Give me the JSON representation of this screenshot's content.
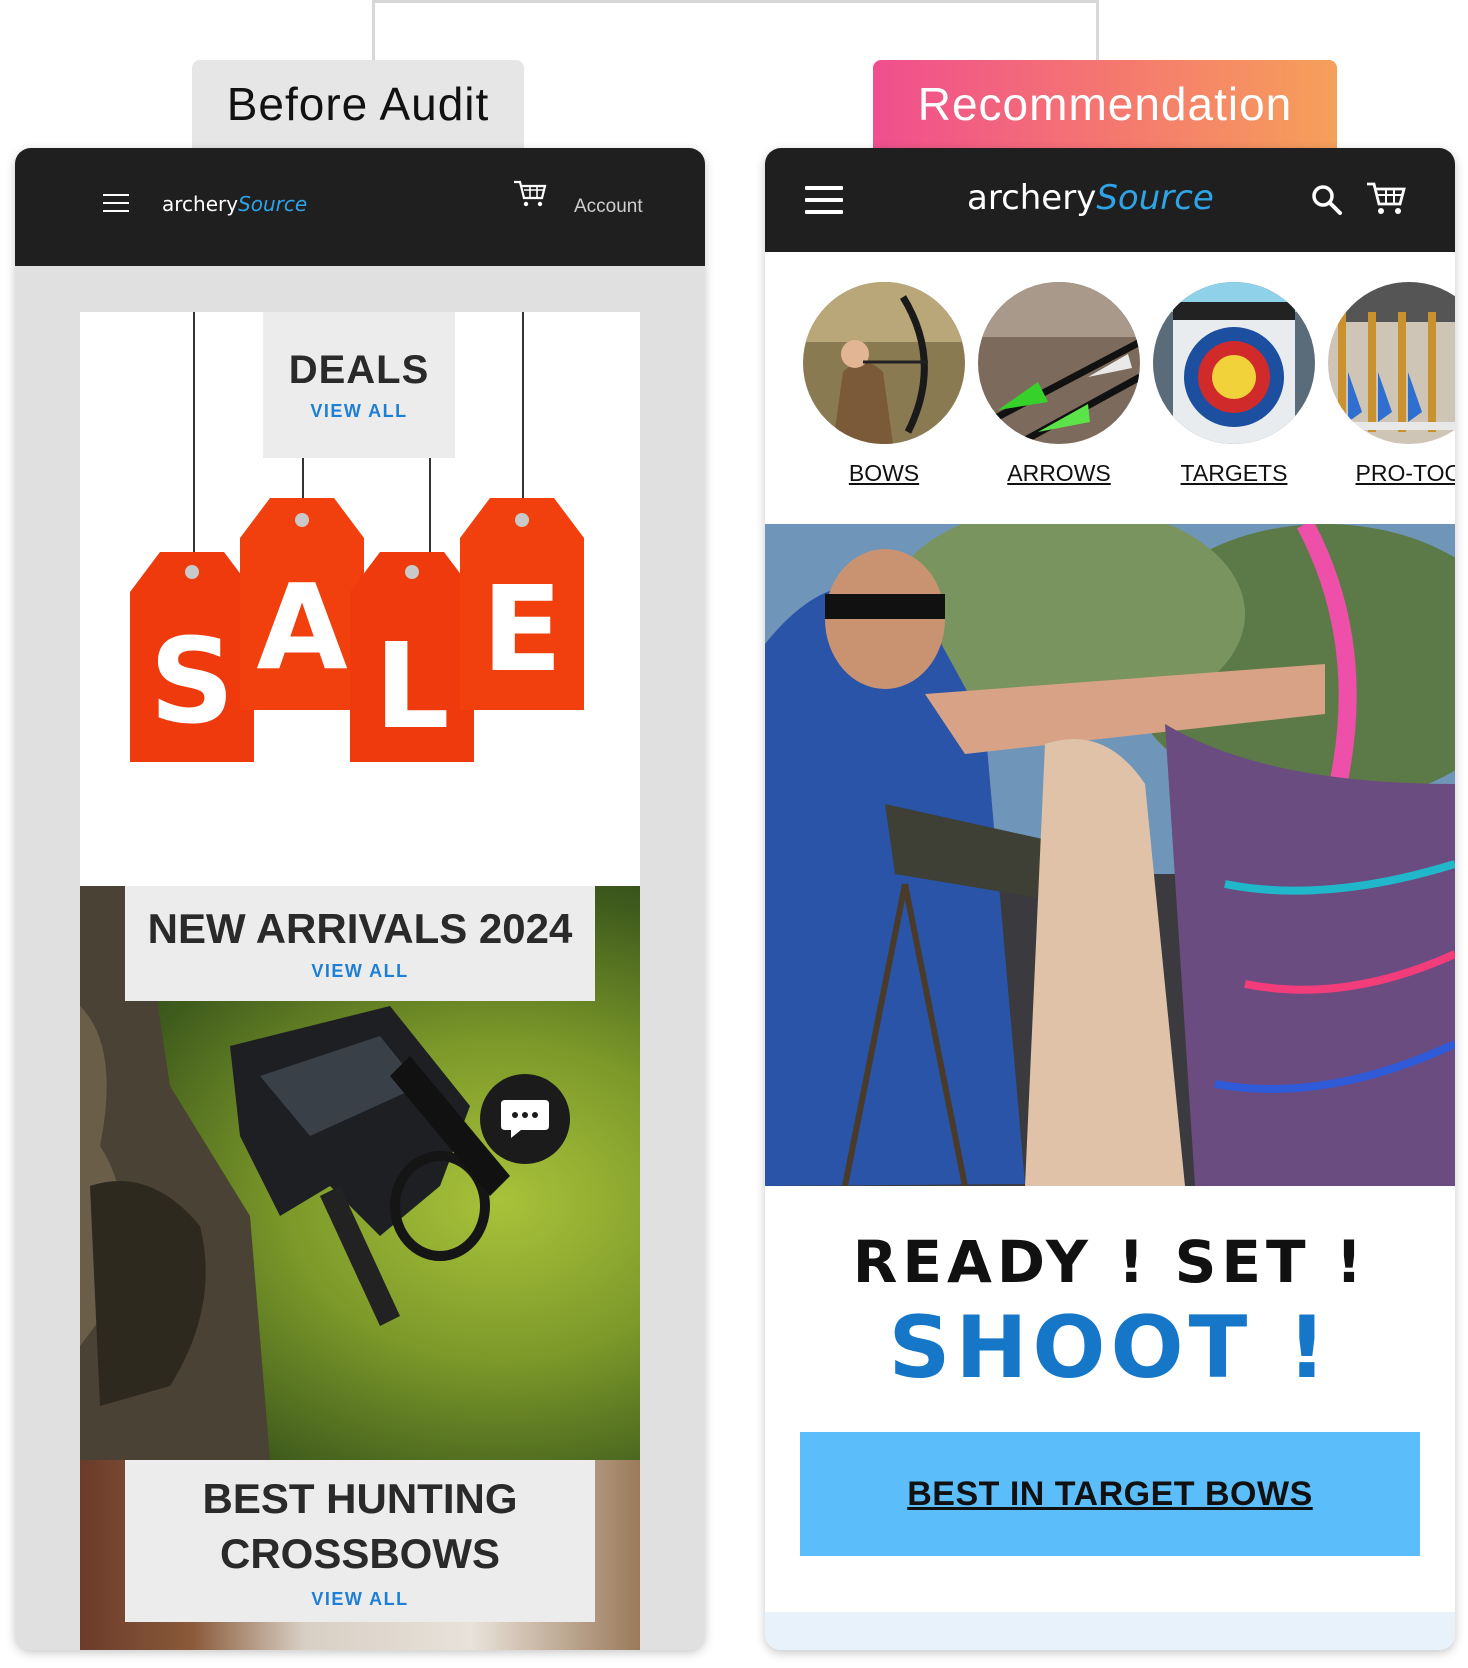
{
  "labels": {
    "before": "Before Audit",
    "recommendation": "Recommendation"
  },
  "left": {
    "header": {
      "logo_word": "archery",
      "logo_accent": "Source",
      "account": "Account"
    },
    "deals": {
      "title": "DEALS",
      "view_all": "VIEW ALL",
      "sale_letters": [
        "S",
        "A",
        "L",
        "E"
      ]
    },
    "arrivals": {
      "title": "NEW ARRIVALS 2024",
      "view_all": "VIEW ALL"
    },
    "hunting": {
      "title_line1": "BEST HUNTING",
      "title_line2": "CROSSBOWS",
      "view_all": "VIEW ALL"
    }
  },
  "right": {
    "header": {
      "logo_word": "archery",
      "logo_accent": "Source"
    },
    "categories": [
      {
        "label": "BOWS"
      },
      {
        "label": "ARROWS"
      },
      {
        "label": "TARGETS"
      },
      {
        "label": "PRO-TOO"
      }
    ],
    "headline_line1": "READY ! SET !",
    "headline_line2": "SHOOT !",
    "cta": "BEST IN TARGET BOWS"
  },
  "colors": {
    "header_bg": "#1f1f1f",
    "accent_blue": "#1677c8",
    "cta_bg": "#5bbdf9",
    "sale_red": "#ee3a0c",
    "rec_gradient_start": "#f04e8e",
    "rec_gradient_end": "#f6a05a"
  }
}
